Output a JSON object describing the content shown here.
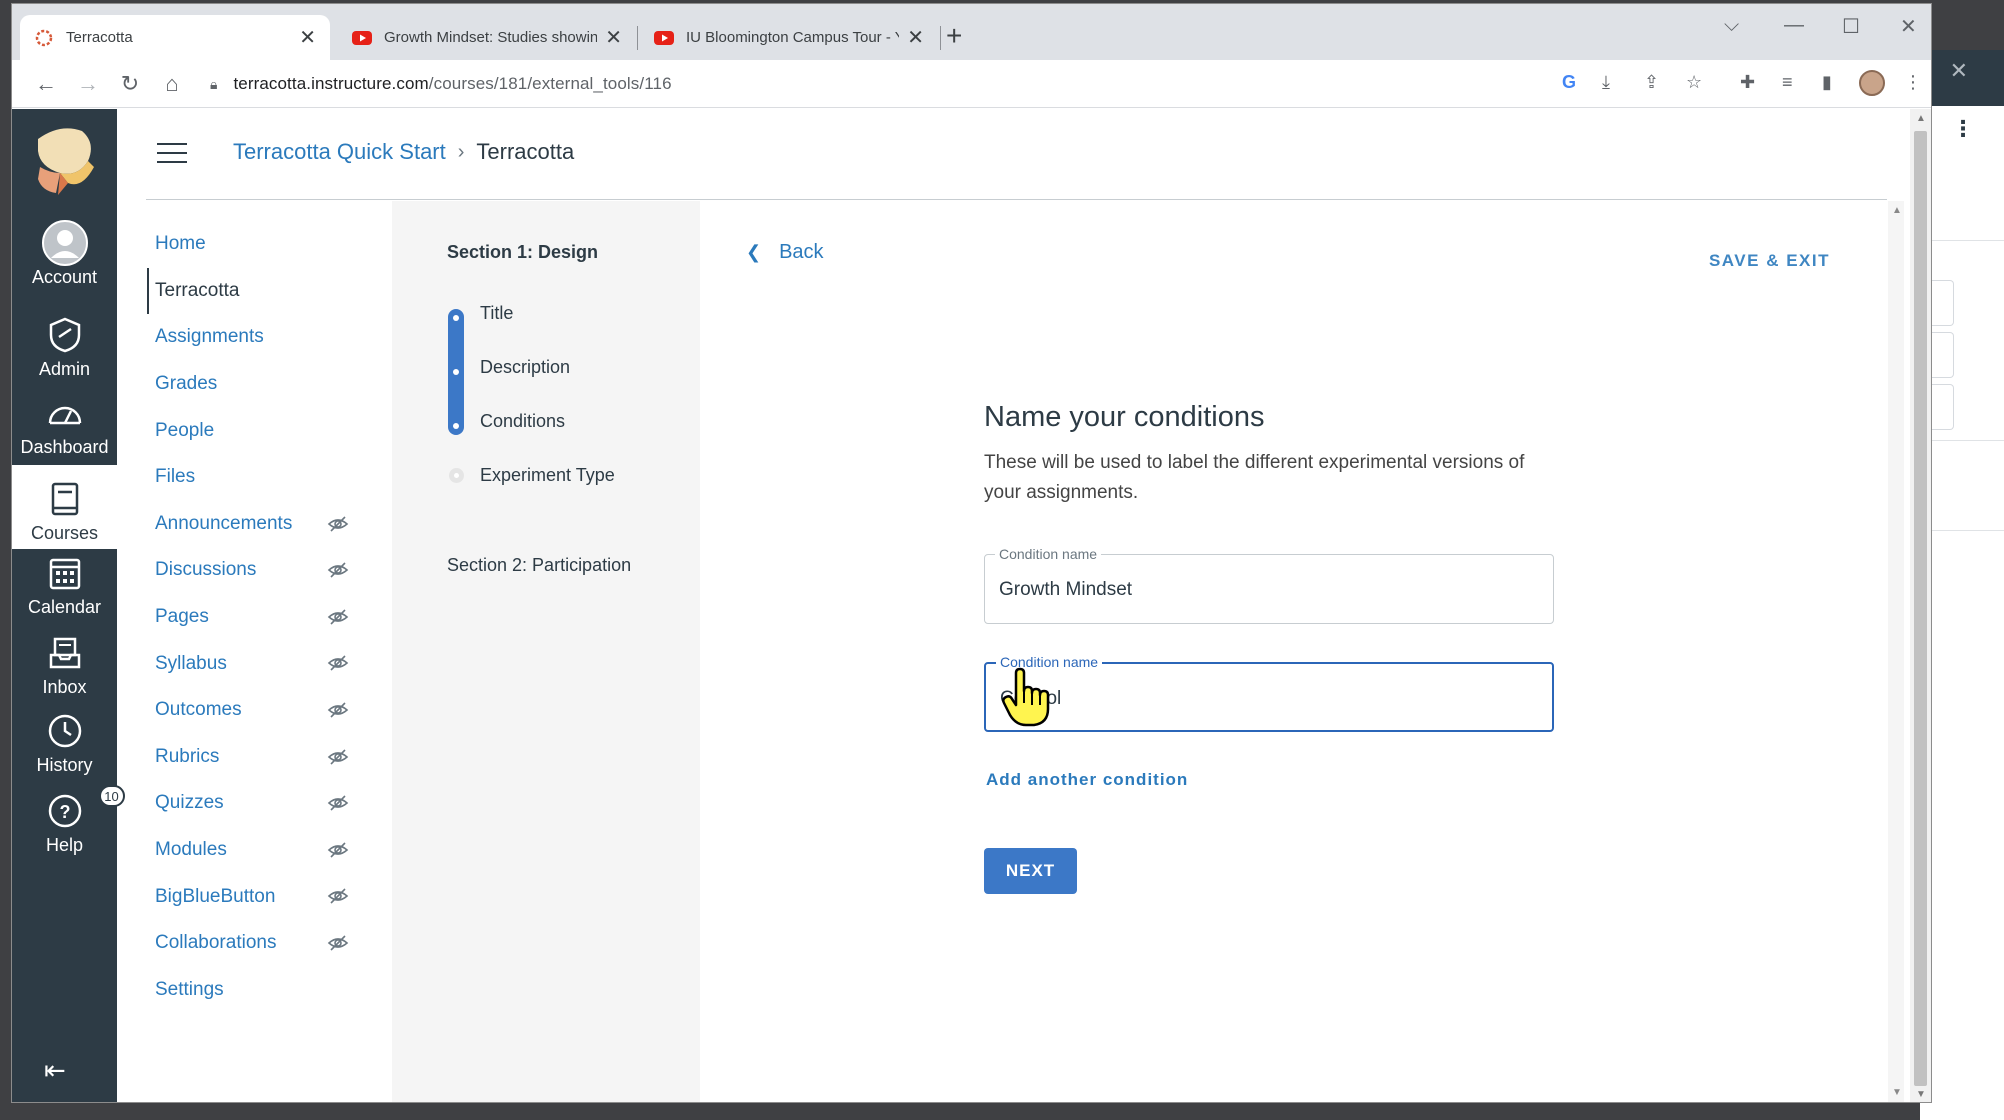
{
  "browser": {
    "tabs": [
      {
        "title": "Terracotta",
        "active": true
      },
      {
        "title": "Growth Mindset: Studies showing",
        "active": false
      },
      {
        "title": "IU Bloomington Campus Tour - Y",
        "active": false
      }
    ],
    "new_tab": "+",
    "window_controls": {
      "dropdown": "⌵",
      "minimize": "—",
      "maximize": "☐",
      "close": "✕"
    },
    "url_host": "terracotta.instructure.com",
    "url_path": "/courses/181/external_tools/116"
  },
  "global_nav": {
    "items": [
      {
        "label": "Account",
        "icon": "account-icon"
      },
      {
        "label": "Admin",
        "icon": "admin-icon"
      },
      {
        "label": "Dashboard",
        "icon": "dashboard-icon"
      },
      {
        "label": "Courses",
        "icon": "courses-icon",
        "active": true
      },
      {
        "label": "Calendar",
        "icon": "calendar-icon"
      },
      {
        "label": "Inbox",
        "icon": "inbox-icon"
      },
      {
        "label": "History",
        "icon": "history-icon"
      },
      {
        "label": "Help",
        "icon": "help-icon",
        "badge": "10"
      }
    ]
  },
  "breadcrumb": {
    "course": "Terracotta Quick Start",
    "separator": "›",
    "page": "Terracotta"
  },
  "course_nav": {
    "items": [
      {
        "label": "Home",
        "hidden": false
      },
      {
        "label": "Terracotta",
        "hidden": false,
        "active": true
      },
      {
        "label": "Assignments",
        "hidden": false
      },
      {
        "label": "Grades",
        "hidden": false
      },
      {
        "label": "People",
        "hidden": false
      },
      {
        "label": "Files",
        "hidden": false
      },
      {
        "label": "Announcements",
        "hidden": true
      },
      {
        "label": "Discussions",
        "hidden": true
      },
      {
        "label": "Pages",
        "hidden": true
      },
      {
        "label": "Syllabus",
        "hidden": true
      },
      {
        "label": "Outcomes",
        "hidden": true
      },
      {
        "label": "Rubrics",
        "hidden": true
      },
      {
        "label": "Quizzes",
        "hidden": true
      },
      {
        "label": "Modules",
        "hidden": true
      },
      {
        "label": "BigBlueButton",
        "hidden": true
      },
      {
        "label": "Collaborations",
        "hidden": true
      },
      {
        "label": "Settings",
        "hidden": false
      }
    ]
  },
  "steps": {
    "section1": "Section 1: Design",
    "items": [
      "Title",
      "Description",
      "Conditions",
      "Experiment Type"
    ],
    "section2": "Section 2: Participation"
  },
  "main": {
    "back": "Back",
    "save_exit": "SAVE & EXIT",
    "title": "Name your conditions",
    "description": "These will be used to label the different experimental versions of your assignments.",
    "fields": [
      {
        "label": "Condition name",
        "value": "Growth Mindset"
      },
      {
        "label": "Condition name",
        "value": "Control"
      }
    ],
    "add_condition": "Add another condition",
    "next": "NEXT"
  },
  "colors": {
    "canvas_nav": "#2d3b45",
    "link": "#2b7abc",
    "primary": "#3c78c7"
  }
}
